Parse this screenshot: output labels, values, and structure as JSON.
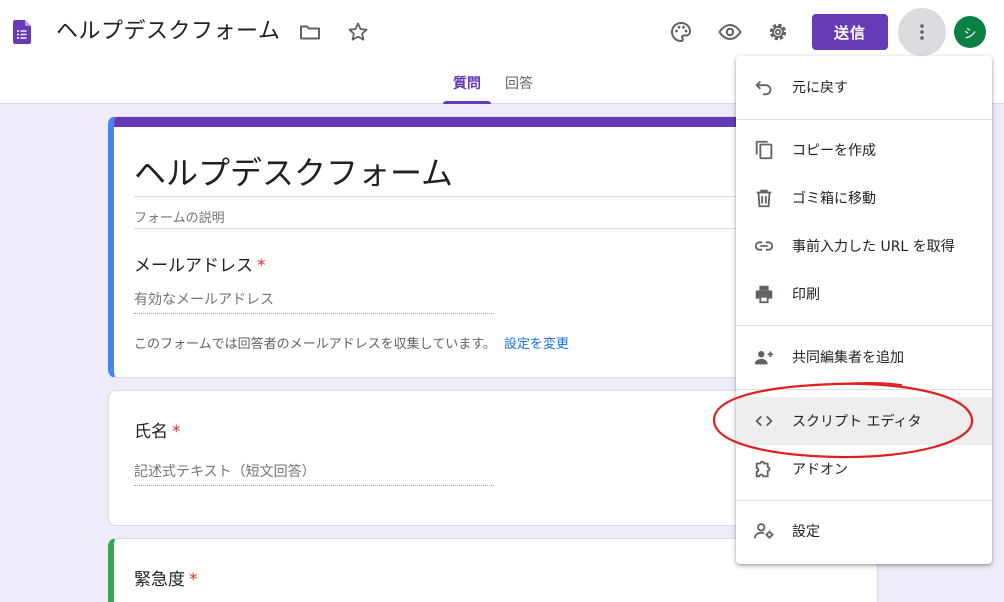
{
  "header": {
    "title": "ヘルプデスクフォーム",
    "send_label": "送信",
    "avatar_initial": "シ",
    "icons": [
      "folder-icon",
      "star-icon",
      "palette-icon",
      "preview-eye-icon",
      "settings-gear-icon",
      "more-vert-icon"
    ]
  },
  "tabs": [
    {
      "label": "質問",
      "active": true
    },
    {
      "label": "回答",
      "active": false
    }
  ],
  "form": {
    "title": "ヘルプデスクフォーム",
    "description_placeholder": "フォームの説明",
    "email": {
      "label": "メールアドレス",
      "required_mark": "*",
      "placeholder": "有効なメールアドレス",
      "note": "このフォームでは回答者のメールアドレスを収集しています。",
      "note_link": "設定を変更"
    },
    "questions": [
      {
        "label": "氏名",
        "required_mark": "*",
        "placeholder": "記述式テキスト（短文回答）"
      },
      {
        "label": "緊急度",
        "required_mark": "*"
      }
    ]
  },
  "menu": {
    "items": [
      {
        "label": "元に戻す",
        "icon": "undo-icon"
      },
      {
        "label": "コピーを作成",
        "icon": "copy-icon"
      },
      {
        "label": "ゴミ箱に移動",
        "icon": "trash-icon"
      },
      {
        "label": "事前入力した URL を取得",
        "icon": "link-icon"
      },
      {
        "label": "印刷",
        "icon": "print-icon"
      },
      {
        "label": "共同編集者を追加",
        "icon": "add-collaborator-icon"
      },
      {
        "label": "スクリプト エディタ",
        "icon": "code-icon"
      },
      {
        "label": "アドオン",
        "icon": "puzzle-icon"
      },
      {
        "label": "設定",
        "icon": "user-settings-icon"
      }
    ]
  },
  "colors": {
    "accent": "#673ab7",
    "background": "#f0ebf8",
    "required": "#d93025",
    "link": "#1a73e8",
    "annotation": "#e02020",
    "avatar": "#0b8043"
  }
}
